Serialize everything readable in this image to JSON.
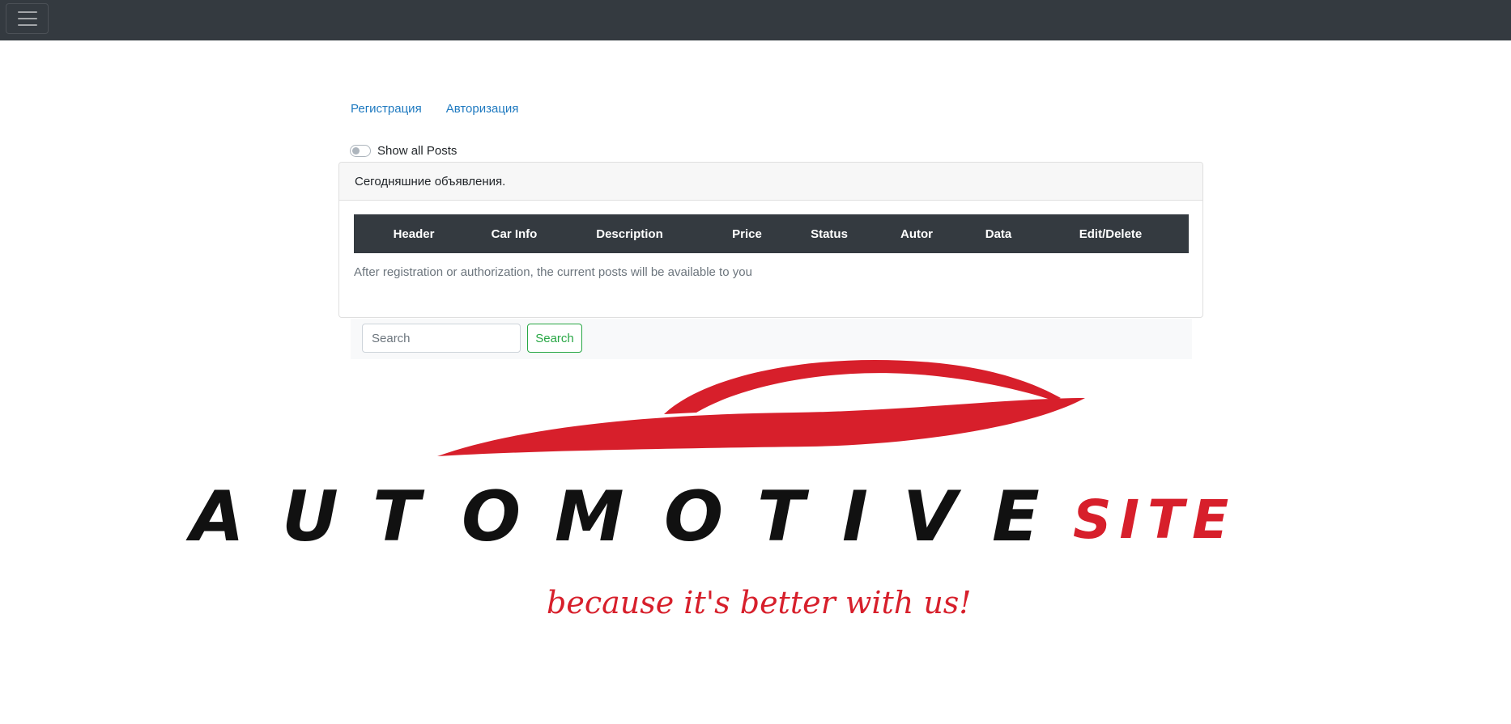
{
  "nav": {
    "menu_icon": "hamburger-menu-icon"
  },
  "auth": {
    "register_label": "Регистрация",
    "login_label": "Авторизация"
  },
  "filter": {
    "show_all_label": "Show all Posts",
    "show_all_checked": false
  },
  "card": {
    "header": "Сегодняшние объявления.",
    "columns": [
      "Header",
      "Car Info",
      "Description",
      "Price",
      "Status",
      "Autor",
      "Data",
      "Edit/Delete"
    ],
    "note": "After registration or authorization, the current posts will be available to you"
  },
  "search": {
    "placeholder": "Search",
    "button_label": "Search"
  },
  "logo": {
    "word": "AUTOMOTIVE",
    "accent_word": "SITE",
    "tagline": "because it's better with us!"
  },
  "colors": {
    "navbar": "#343a40",
    "link": "#1f7ac0",
    "success": "#28a745",
    "logo_red": "#d71f2b"
  }
}
